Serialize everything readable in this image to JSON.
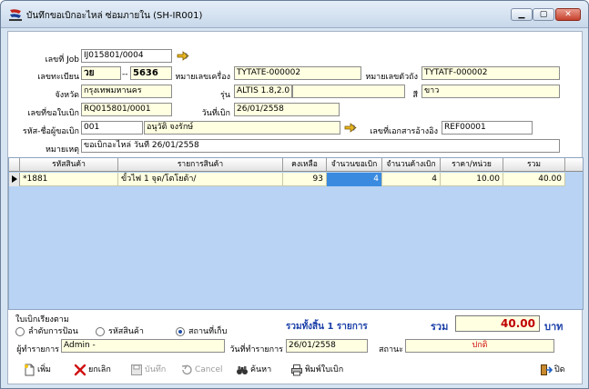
{
  "window": {
    "title": "บันทึกขอเบิกอะไหล่ ซ่อมภายใน (SH-IR001)"
  },
  "form": {
    "job_label": "เลขที่ Job",
    "job_value": "IJ015801/0004",
    "plate_label": "เลขทะเบียน",
    "plate_prefix": "วย",
    "plate_dash": "--",
    "plate_number": "5636",
    "engine_label": "หมายเลขเครื่อง",
    "engine_value": "TYTATE-000002",
    "chassis_label": "หมายเลขตัวถัง",
    "chassis_value": "TYTATF-000002",
    "province_label": "จังหวัด",
    "province_value": "กรุงเทพมหานคร",
    "model_label": "รุ่น",
    "model_value": "ALTIS 1.8,2.0",
    "model_extra": "",
    "color_label": "สี",
    "color_value": "ขาว",
    "request_no_label": "เลขที่ขอใบเบิก",
    "request_no_value": "RQ015801/0001",
    "request_date_label": "วันที่เบิก",
    "request_date_value": "26/01/2558",
    "requester_label": "รหัส-ชื่อผู้ขอเบิก",
    "requester_code": "001",
    "requester_name": "อนุวัติ จงรักษ์",
    "ref_label": "เลขที่เอกสารอ้างอิง",
    "ref_value": "REF00001",
    "note_label": "หมายเหตุ",
    "note_value": "ขอเบิกอะไหล่ วันที่ 26/01/2558"
  },
  "grid": {
    "columns": [
      "รหัสสินค้า",
      "รายการสินค้า",
      "คงเหลือ",
      "จำนวนขอเบิก",
      "จำนวนค้างเบิก",
      "ราคา/หน่วย",
      "รวม"
    ],
    "rows": [
      {
        "code": "*1881",
        "name": "ขั้วไฟ 1 จุด/โตโยต้า/",
        "remain": "93",
        "request_qty": "4",
        "pending_qty": "4",
        "unit_price": "10.00",
        "total": "40.00"
      }
    ]
  },
  "sort": {
    "title": "ใบเบิกเรียงตาม",
    "options": [
      "ลำดับการป้อน",
      "รหัสสินค้า",
      "สถานที่เก็บ"
    ],
    "selected": "สถานที่เก็บ"
  },
  "summary": {
    "count_text": "รวมทั้งสิ้น 1 รายการ",
    "total_label": "รวม",
    "total_value": "40.00",
    "currency": "บาท"
  },
  "footer": {
    "user_label": "ผู้ทำรายการ",
    "user_value": "Admin -",
    "tx_date_label": "วันที่ทำรายการ",
    "tx_date_value": "26/01/2558",
    "status_label": "สถานะ",
    "status_value": "ปกติ"
  },
  "toolbar": {
    "new": "เพิ่ม",
    "cancel_doc": "ยกเลิก",
    "save": "บันทึก",
    "cancel": "Cancel",
    "search": "ค้นหา",
    "print": "พิมพ์ใบเบิก",
    "close": "ปิด"
  },
  "colors": {
    "accent": "#1a3fa8",
    "total_red": "#c00000",
    "field_yellow": "#ffffe1",
    "grid_bg": "#b8d3f4",
    "selected_cell": "#3a8be0"
  }
}
